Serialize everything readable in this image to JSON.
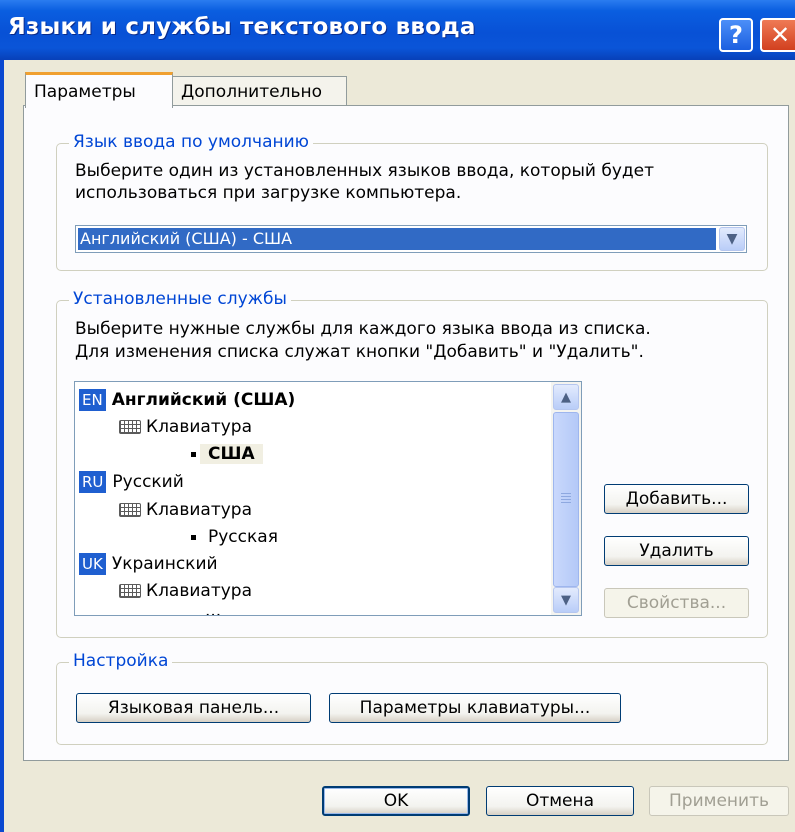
{
  "window": {
    "title": "Языки и службы текстового ввода",
    "help_glyph": "?",
    "close_glyph": "✕"
  },
  "tabs": [
    {
      "label": "Параметры",
      "active": true
    },
    {
      "label": "Дополнительно",
      "active": false
    }
  ],
  "default_language": {
    "legend": "Язык ввода по умолчанию",
    "description_line1": "Выберите один из установленных языков ввода, который будет",
    "description_line2": "использоваться при загрузке компьютера.",
    "selected_value": "Английский (США) - США"
  },
  "installed_services": {
    "legend": "Установленные службы",
    "description_line1": "Выберите нужные службы для каждого языка ввода из списка.",
    "description_line2": "Для изменения списка служат кнопки \"Добавить\" и \"Удалить\".",
    "tree": [
      {
        "badge": "EN",
        "name": "Английский (США)",
        "service": "Клавиатура",
        "layout": "США"
      },
      {
        "badge": "RU",
        "name": "Русский",
        "service": "Клавиатура",
        "layout": "Русская"
      },
      {
        "badge": "UK",
        "name": "Украинский",
        "service": "Клавиатура",
        "layout": "..."
      }
    ],
    "buttons": {
      "add": "Добавить...",
      "remove": "Удалить",
      "properties": "Свойства..."
    }
  },
  "settings": {
    "legend": "Настройка",
    "language_bar_button": "Языковая панель...",
    "keyboard_settings_button": "Параметры клавиатуры..."
  },
  "footer": {
    "ok": "OK",
    "cancel": "Отмена",
    "apply": "Применить"
  },
  "colors": {
    "titlebar": "#0a5ee0",
    "selection": "#316ac5",
    "legend_text": "#0046d5",
    "dialog_bg": "#ece9d8"
  }
}
